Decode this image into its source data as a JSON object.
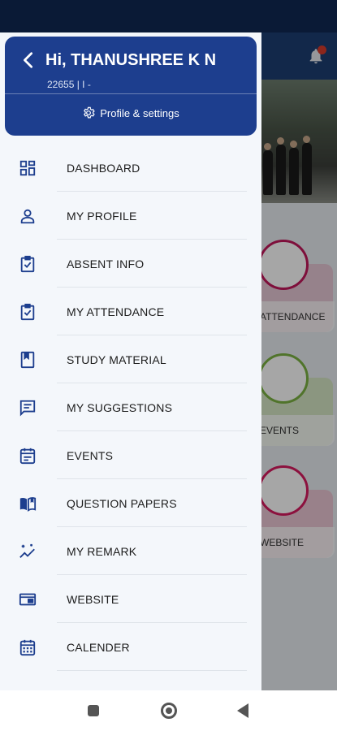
{
  "header": {
    "greeting": "Hi, THANUSHREE K N",
    "sub_info": "22655  |  I -",
    "profile_settings_label": "Profile & settings"
  },
  "menu": {
    "items": [
      {
        "label": "DASHBOARD",
        "icon": "dashboard-icon"
      },
      {
        "label": "MY PROFILE",
        "icon": "person-icon"
      },
      {
        "label": "ABSENT INFO",
        "icon": "clipboard-check-icon"
      },
      {
        "label": "MY ATTENDANCE",
        "icon": "clipboard-check-icon"
      },
      {
        "label": "STUDY MATERIAL",
        "icon": "book-icon"
      },
      {
        "label": "MY SUGGESTIONS",
        "icon": "chat-icon"
      },
      {
        "label": "EVENTS",
        "icon": "event-icon"
      },
      {
        "label": "QUESTION PAPERS",
        "icon": "open-book-icon"
      },
      {
        "label": "MY REMARK",
        "icon": "sparkle-chart-icon"
      },
      {
        "label": "WEBSITE",
        "icon": "web-window-icon"
      },
      {
        "label": "CALENDER",
        "icon": "calendar-icon"
      }
    ]
  },
  "background_cards": [
    {
      "label": "ATTENDANCE",
      "color": "#c2185b"
    },
    {
      "label": "EVENTS",
      "color": "#7cb342"
    },
    {
      "label": "WEBSITE",
      "color": "#d81b60"
    }
  ],
  "colors": {
    "drawer_header": "#1d3e8e",
    "icon": "#1d3e8e",
    "status_bar": "#0a1a36"
  }
}
